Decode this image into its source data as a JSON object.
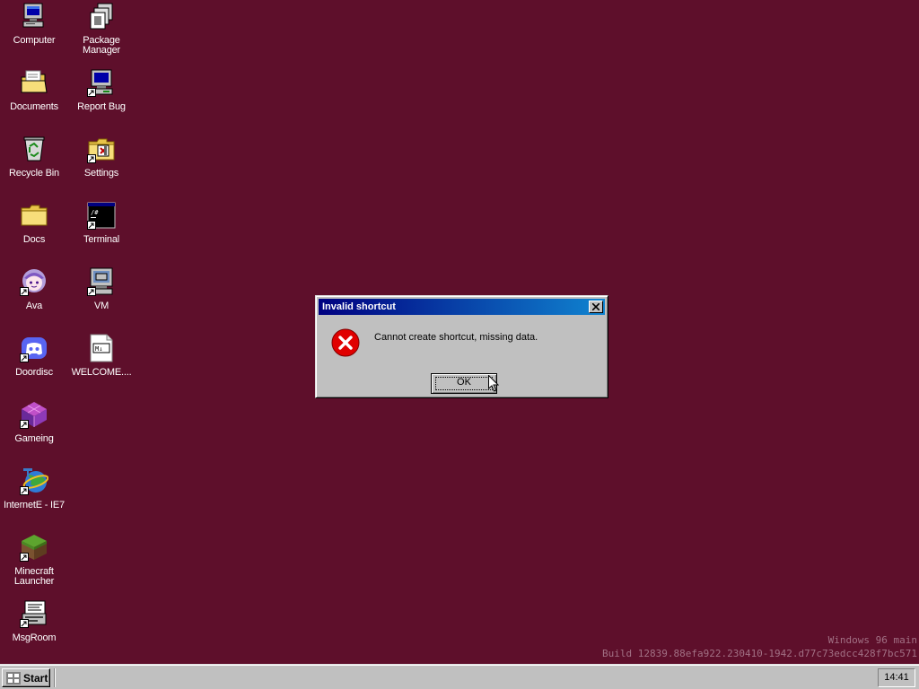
{
  "desktop": {
    "background": "#5e0f2b",
    "icons": [
      {
        "label": "Computer",
        "icon": "computer-icon"
      },
      {
        "label": "Package Manager",
        "icon": "package-manager-icon"
      },
      {
        "label": "Documents",
        "icon": "documents-folder-icon"
      },
      {
        "label": "Report Bug",
        "icon": "report-bug-icon"
      },
      {
        "label": "Recycle Bin",
        "icon": "recycle-bin-icon"
      },
      {
        "label": "Settings",
        "icon": "settings-folder-icon"
      },
      {
        "label": "Docs",
        "icon": "folder-icon"
      },
      {
        "label": "Terminal",
        "icon": "terminal-icon"
      },
      {
        "label": "Ava",
        "icon": "ava-icon"
      },
      {
        "label": "VM",
        "icon": "vm-icon"
      },
      {
        "label": "Doordisc",
        "icon": "doordisc-icon"
      },
      {
        "label": "WELCOME....",
        "icon": "markdown-file-icon"
      },
      {
        "label": "Gameing",
        "icon": "gameing-icon"
      },
      {
        "label": "InternetE - IE7",
        "icon": "internet-explorer-icon"
      },
      {
        "label": "Minecraft Launcher",
        "icon": "minecraft-icon"
      },
      {
        "label": "MsgRoom",
        "icon": "msgroom-icon"
      }
    ],
    "watermark": {
      "line1": "Windows 96 main",
      "line2": "Build 12839.88efa922.230410-1942.d77c73edcc428f7bc571"
    }
  },
  "dialog": {
    "title": "Invalid shortcut",
    "message": "Cannot create shortcut, missing data.",
    "ok_label": "OK",
    "icon": "error-icon"
  },
  "taskbar": {
    "start_label": "Start",
    "clock": "14:41"
  }
}
